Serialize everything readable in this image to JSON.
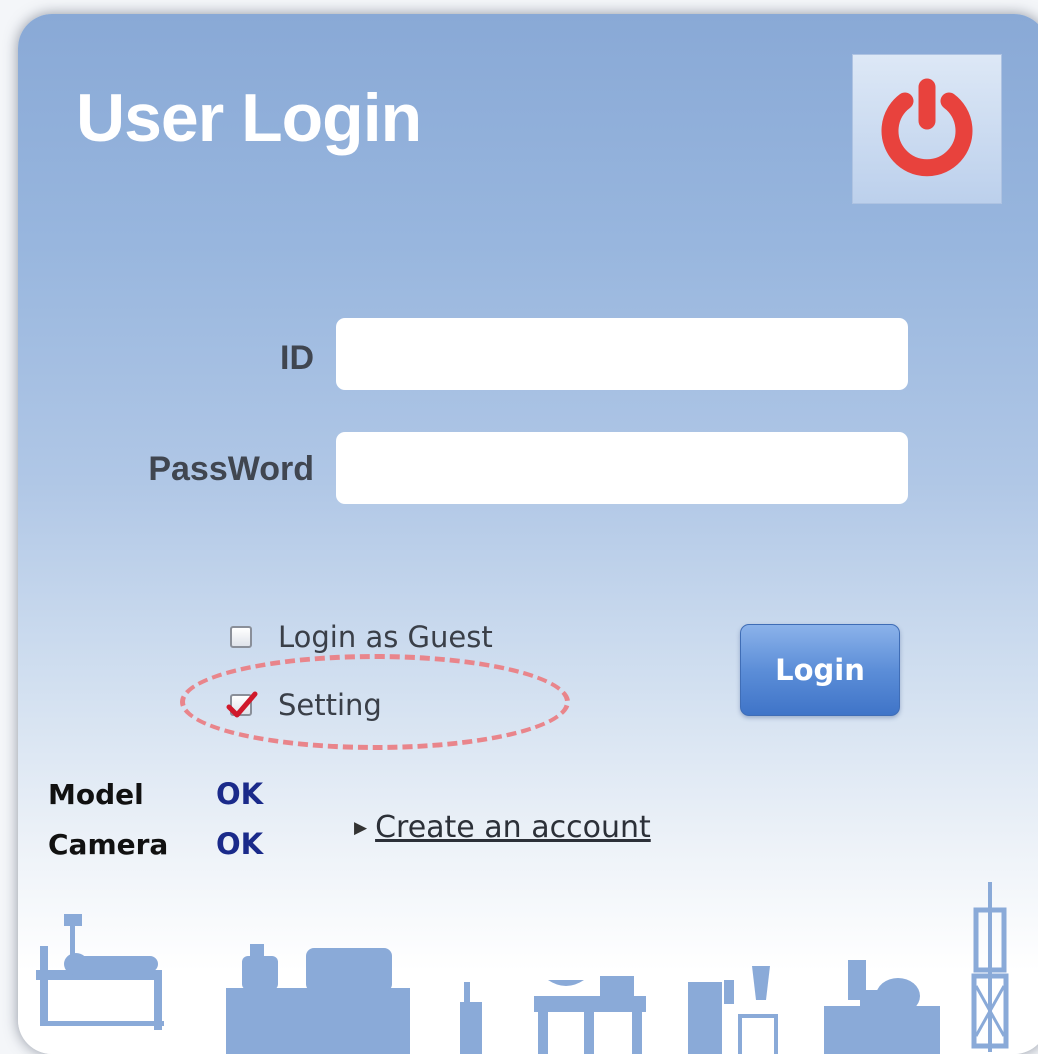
{
  "title": "User Login",
  "power_button": {
    "icon": "power-icon",
    "color": "#e8423d"
  },
  "form": {
    "id_label": "ID",
    "id_value": "",
    "password_label": "PassWord",
    "password_value": ""
  },
  "options": {
    "guest_label": "Login as Guest",
    "guest_checked": false,
    "setting_label": "Setting",
    "setting_checked": true
  },
  "login_button_label": "Login",
  "status": {
    "model_label": "Model",
    "model_value": "OK",
    "camera_label": "Camera",
    "camera_value": "OK"
  },
  "create_account_label": "Create an account",
  "colors": {
    "panel_top": "#89a9d6",
    "status_ok": "#1a2a8a",
    "highlight_dashed": "#e9858b",
    "silhouette": "#8aaad8"
  }
}
